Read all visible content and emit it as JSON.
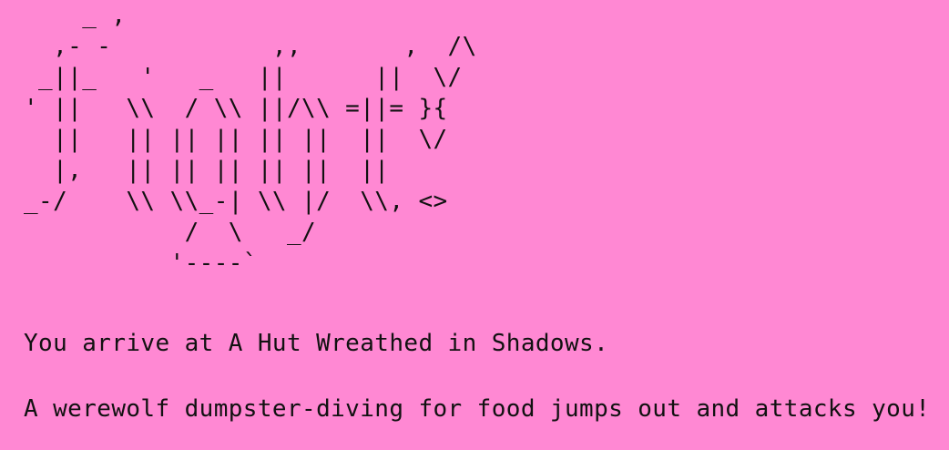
{
  "game": {
    "ascii_title": "    _ ,\n  ,- -           ,,       ,  /\\\n _||_   '   _   ||      ||  \\/\n' ||   \\\\  / \\\\ ||/\\\\ =||= }{\n  ||   || || || || ||  ||  \\/\n  |,   || || || || ||  ||\n_-/    \\\\ \\\\_-| \\\\ |/  \\\\, <>\n           /  \\   _/\n          '----`",
    "location_message": "You arrive at A Hut Wreathed in Shadows.",
    "encounter_message": "A werewolf dumpster-diving for food jumps out and attacks you!"
  },
  "colors": {
    "background": "#ff88d3",
    "text": "#111111"
  }
}
